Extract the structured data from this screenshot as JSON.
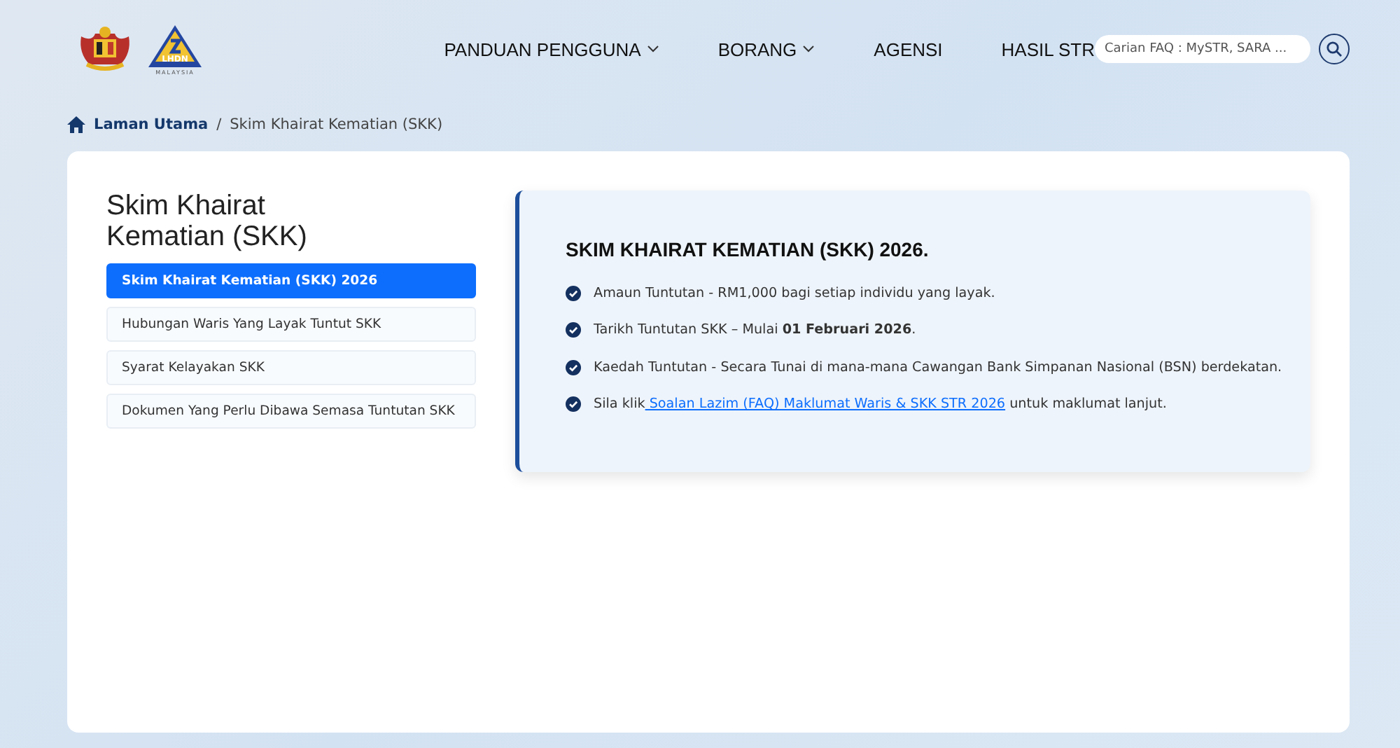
{
  "header": {
    "logo_text": "LHDN",
    "logo_subtext": "MALAYSIA",
    "nav": [
      {
        "label": "PANDUAN PENGGUNA",
        "dropdown": true
      },
      {
        "label": "BORANG",
        "dropdown": true
      },
      {
        "label": "AGENSI",
        "dropdown": false
      },
      {
        "label": "HASIL STR",
        "dropdown": false
      }
    ],
    "search": {
      "placeholder": "Carian FAQ : MySTR, SARA ..."
    }
  },
  "breadcrumb_separator": "/",
  "breadcrumb": [
    {
      "label": "Laman Utama",
      "kind": "link"
    },
    {
      "label": "Skim Khairat Kematian (SKK)",
      "kind": "current"
    }
  ],
  "sidebar": {
    "title": "Skim Khairat Kematian (SKK)",
    "items": [
      {
        "label": "Skim Khairat Kematian (SKK) 2026",
        "selected": true
      },
      {
        "label": "Hubungan Waris Yang Layak Tuntut SKK",
        "selected": false
      },
      {
        "label": "Syarat Kelayakan SKK",
        "selected": false
      },
      {
        "label": "Dokumen Yang Perlu Dibawa Semasa Tuntutan SKK",
        "selected": false
      }
    ]
  },
  "content": {
    "title": "SKIM KHAIRAT KEMATIAN (SKK) 2026.",
    "items": [
      {
        "kind": "text",
        "text": "Amaun Tuntutan - RM1,000 bagi setiap individu yang layak."
      },
      {
        "kind": "text",
        "text": "Tarikh Tuntutan SKK – Mulai **01 Februari 2026**."
      },
      {
        "kind": "text",
        "text": "Kaedah Tuntutan - Secara Tunai di mana-mana Cawangan Bank Simpanan Nasional (BSN) berdekatan."
      },
      {
        "kind": "link",
        "before": "Sila klik",
        "link": " Soalan Lazim (FAQ) Maklumat Waris & SKK STR 2026",
        "after": " untuk maklumat lanjut."
      }
    ]
  }
}
